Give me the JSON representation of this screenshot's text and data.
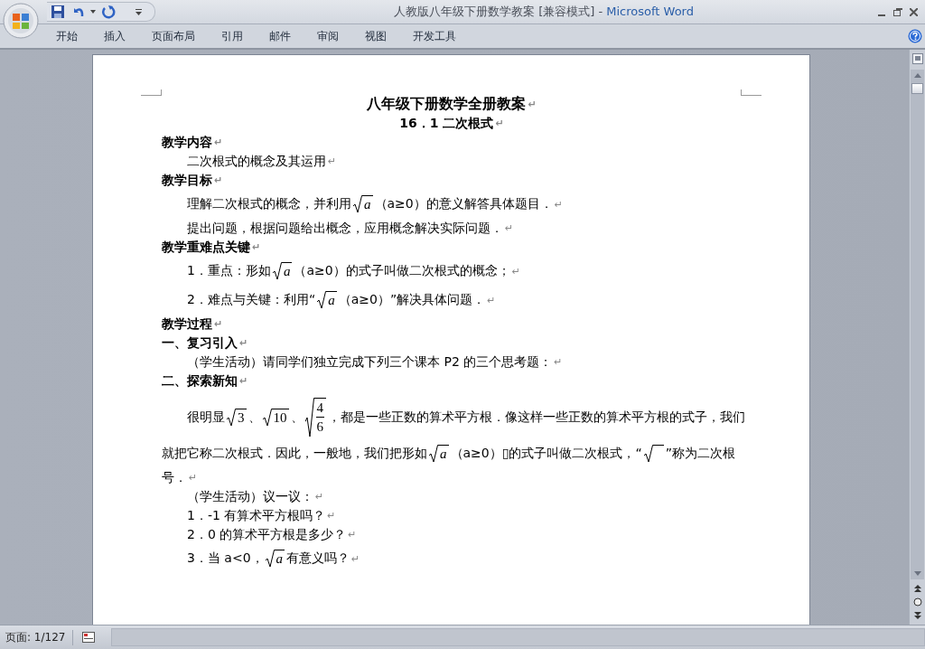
{
  "window": {
    "title": "人教版八年级下册数学教案 [兼容模式] - ",
    "app_name": "Microsoft Word"
  },
  "ribbon_tabs": [
    {
      "label": "开始",
      "selected": false
    },
    {
      "label": "插入",
      "selected": false
    },
    {
      "label": "页面布局",
      "selected": false
    },
    {
      "label": "引用",
      "selected": false
    },
    {
      "label": "邮件",
      "selected": false
    },
    {
      "label": "审阅",
      "selected": false
    },
    {
      "label": "视图",
      "selected": false
    },
    {
      "label": "开发工具",
      "selected": false
    }
  ],
  "document": {
    "paragraphs": [
      {
        "kind": "title",
        "end_mark": "↵",
        "lines": [
          [
            {
              "kind": "text",
              "text": "八年级下册数学全册教案"
            }
          ]
        ]
      },
      {
        "kind": "subtitle",
        "end_mark": "↵",
        "lines": [
          [
            {
              "kind": "text",
              "text": "16．1  二次根式"
            }
          ]
        ]
      },
      {
        "kind": "heading",
        "end_mark": "↵",
        "lines": [
          [
            {
              "kind": "text",
              "text": "教学内容"
            }
          ]
        ]
      },
      {
        "kind": "body",
        "end_mark": "↵",
        "lines": [
          [
            {
              "kind": "text",
              "text": "二次根式的概念及其运用"
            }
          ]
        ]
      },
      {
        "kind": "heading",
        "end_mark": "↵",
        "lines": [
          [
            {
              "kind": "text",
              "text": "教学目标"
            }
          ]
        ]
      },
      {
        "kind": "body",
        "end_mark": "↵",
        "lines": [
          [
            {
              "kind": "text",
              "text": "理解二次根式的概念，并利用"
            },
            {
              "kind": "sqrt",
              "text": "a"
            },
            {
              "kind": "text",
              "text": "（a≥0）的意义解答具体题目．"
            }
          ]
        ]
      },
      {
        "kind": "body",
        "end_mark": "↵",
        "lines": [
          [
            {
              "kind": "text",
              "text": "提出问题，根据问题给出概念，应用概念解决实际问题．"
            }
          ]
        ]
      },
      {
        "kind": "heading",
        "end_mark": "↵",
        "lines": [
          [
            {
              "kind": "text",
              "text": "教学重难点关键"
            }
          ]
        ]
      },
      {
        "kind": "body",
        "end_mark": "↵",
        "lines": [
          [
            {
              "kind": "text",
              "text": "1．重点：形如"
            },
            {
              "kind": "sqrt",
              "text": "a"
            },
            {
              "kind": "text",
              "text": "（a≥0）的式子叫做二次根式的概念；"
            }
          ]
        ]
      },
      {
        "kind": "body",
        "end_mark": "↵",
        "lines": [
          [
            {
              "kind": "text",
              "text": "2．难点与关键：利用“"
            },
            {
              "kind": "sqrt",
              "text": "a"
            },
            {
              "kind": "text",
              "text": "（a≥0）”解决具体问题．"
            }
          ]
        ]
      },
      {
        "kind": "heading",
        "end_mark": "↵",
        "lines": [
          [
            {
              "kind": "text",
              "text": "教学过程"
            }
          ]
        ]
      },
      {
        "kind": "heading",
        "end_mark": "↵",
        "lines": [
          [
            {
              "kind": "text",
              "text": "一、复习引入"
            }
          ]
        ]
      },
      {
        "kind": "body",
        "end_mark": "↵",
        "lines": [
          [
            {
              "kind": "text",
              "text": "（学生活动）请同学们独立完成下列三个课本 P2 的三个思考题："
            }
          ]
        ]
      },
      {
        "kind": "heading",
        "end_mark": "↵",
        "lines": [
          [
            {
              "kind": "text",
              "text": "二、探索新知"
            }
          ]
        ]
      },
      {
        "kind": "body",
        "end_mark": "↵",
        "lines": [
          [
            {
              "kind": "text",
              "text": "很明显"
            },
            {
              "kind": "sqrt",
              "text": "3"
            },
            {
              "kind": "text",
              "text": "、"
            },
            {
              "kind": "sqrt",
              "text": "10"
            },
            {
              "kind": "text",
              "text": "、"
            },
            {
              "kind": "sqrt-fraction",
              "numerator": "4",
              "denominator": "6"
            },
            {
              "kind": "text",
              "text": "，都是一些正数的算术平方根．像这样一些正数的算术平方根的式子，我们"
            }
          ],
          [
            {
              "kind": "text",
              "text": "就把它称二次根式．因此，一般地，我们把形如"
            },
            {
              "kind": "sqrt",
              "text": "a"
            },
            {
              "kind": "text",
              "text": "（a≥0）▯的式子叫做二次根式，“"
            },
            {
              "kind": "radical"
            },
            {
              "kind": "text",
              "text": "”称为二次根"
            }
          ],
          [
            {
              "kind": "text",
              "text": "号．"
            }
          ]
        ]
      },
      {
        "kind": "body",
        "end_mark": "↵",
        "lines": [
          [
            {
              "kind": "text",
              "text": "（学生活动）议一议："
            }
          ]
        ]
      },
      {
        "kind": "body",
        "end_mark": "↵",
        "lines": [
          [
            {
              "kind": "text",
              "text": "1．-1 有算术平方根吗？"
            }
          ]
        ]
      },
      {
        "kind": "body",
        "end_mark": "↵",
        "lines": [
          [
            {
              "kind": "text",
              "text": "2．0 的算术平方根是多少？"
            }
          ]
        ]
      },
      {
        "kind": "body",
        "end_mark": "↵",
        "lines": [
          [
            {
              "kind": "text",
              "text": "3．当 a<0，"
            },
            {
              "kind": "sqrt",
              "text": "a"
            },
            {
              "kind": "text",
              "text": "有意义吗？"
            }
          ]
        ]
      }
    ]
  },
  "status_bar": {
    "page": "页面: 1/127"
  }
}
